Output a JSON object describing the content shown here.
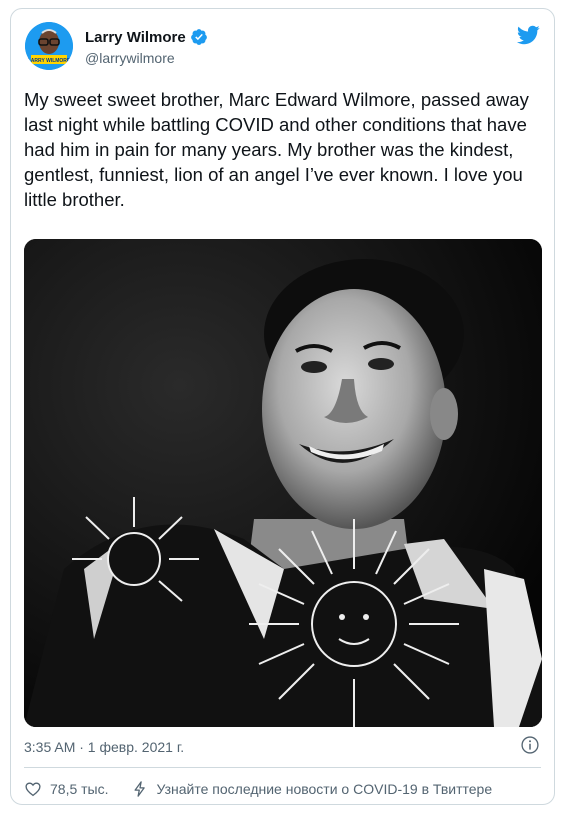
{
  "author": {
    "name": "Larry Wilmore",
    "handle": "@larrywilmore",
    "avatar_badge": "LARRY WILMORE",
    "verified_icon": "verified-badge-icon"
  },
  "tweet": {
    "text": "My sweet sweet brother, Marc Edward Wilmore, passed away last night while battling COVID and other conditions that have had him in pain for many years. My brother was the kindest, gentlest, funniest, lion of an angel I’ve ever known. I love you little brother.",
    "timestamp": "3:35 AM · 1 февр. 2021 г."
  },
  "actions": {
    "likes": "78,5 тыс.",
    "covid_link": "Узнайте последние новости о COVID-19 в Твиттере"
  },
  "icons": [
    "twitter-bird-icon",
    "verified-badge-icon",
    "info-icon",
    "heart-icon",
    "lightning-icon"
  ],
  "colors": {
    "brand": "#1d9bf0",
    "secondary_text": "#536471",
    "border": "#cfd9de"
  }
}
